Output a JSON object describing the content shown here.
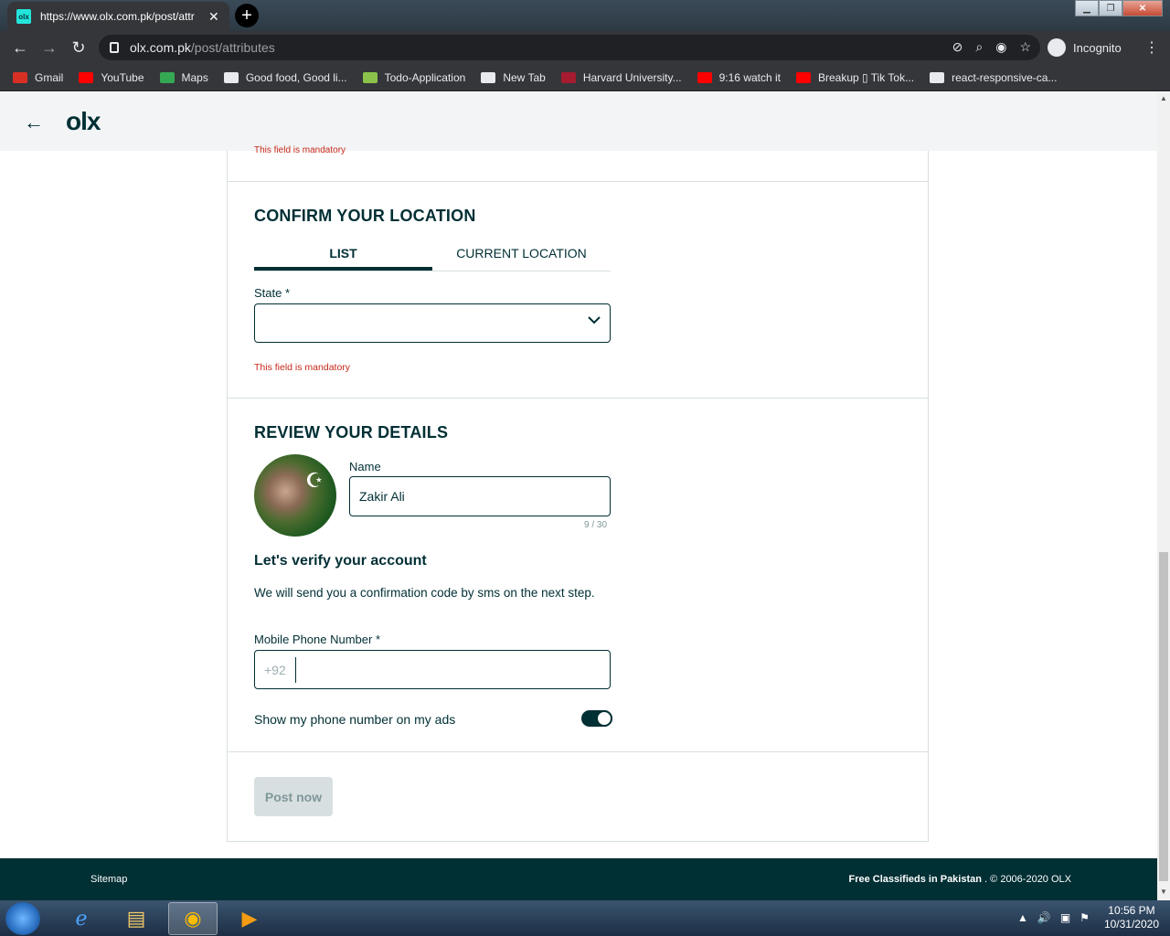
{
  "browser": {
    "tab_title": "https://www.olx.com.pk/post/attr",
    "url_host": "olx.com.pk",
    "url_path": "/post/attributes",
    "incognito_label": "Incognito",
    "bookmarks": [
      {
        "label": "Gmail",
        "icon": "gmail-icon",
        "color": "#d93025"
      },
      {
        "label": "YouTube",
        "icon": "youtube-icon",
        "color": "#ff0000"
      },
      {
        "label": "Maps",
        "icon": "maps-icon",
        "color": "#34a853"
      },
      {
        "label": "Good food, Good li...",
        "icon": "globe-icon",
        "color": "#e8eaed"
      },
      {
        "label": "Todo-Application",
        "icon": "todo-icon",
        "color": "#8bc34a"
      },
      {
        "label": "New Tab",
        "icon": "globe-icon",
        "color": "#e8eaed"
      },
      {
        "label": "Harvard University...",
        "icon": "harvard-icon",
        "color": "#a51c30"
      },
      {
        "label": "9:16 watch it",
        "icon": "youtube-icon",
        "color": "#ff0000"
      },
      {
        "label": "Breakup ▯ Tik Tok...",
        "icon": "youtube-icon",
        "color": "#ff0000"
      },
      {
        "label": "react-responsive-ca...",
        "icon": "react-icon",
        "color": "#e8eaed"
      }
    ]
  },
  "header": {
    "logo": "olx"
  },
  "hidden_error": "This field is mandatory",
  "location": {
    "title": "CONFIRM YOUR LOCATION",
    "tabs": [
      "LIST",
      "CURRENT LOCATION"
    ],
    "state_label": "State *",
    "state_value": "",
    "error": "This field is mandatory"
  },
  "review": {
    "title": "REVIEW YOUR DETAILS",
    "name_label": "Name",
    "name_value": "Zakir Ali",
    "name_counter": "9 / 30",
    "verify_title": "Let's verify your account",
    "verify_text": "We will send you a confirmation code by sms on the next step.",
    "phone_label": "Mobile Phone Number *",
    "phone_prefix": "+92",
    "phone_value": "",
    "show_phone_label": "Show my phone number on my ads",
    "show_phone_enabled": true,
    "post_button": "Post now"
  },
  "footer": {
    "sitemap": "Sitemap",
    "tagline": "Free Classifieds in Pakistan",
    "copyright": ". © 2006-2020 OLX"
  },
  "taskbar": {
    "time": "10:56 PM",
    "date": "10/31/2020"
  }
}
